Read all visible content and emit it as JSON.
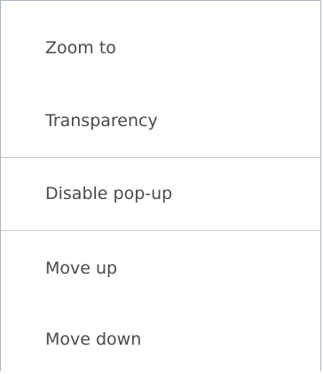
{
  "menu": {
    "items": [
      {
        "label": "Zoom to"
      },
      {
        "label": "Transparency"
      },
      {
        "label": "Disable pop-up"
      },
      {
        "label": "Move up"
      },
      {
        "label": "Move down"
      }
    ]
  }
}
